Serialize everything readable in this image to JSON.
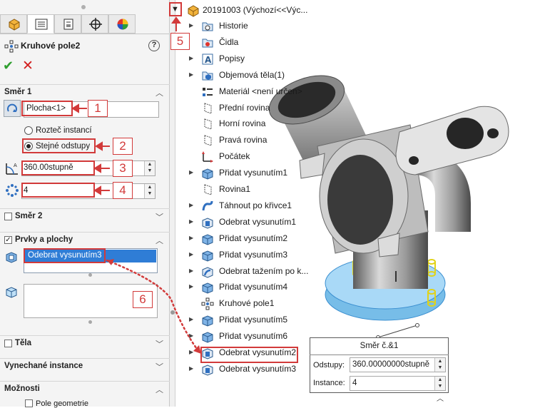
{
  "tabs": [
    {
      "name": "feature-manager",
      "icon": "part-cube-icon"
    },
    {
      "name": "property-manager",
      "icon": "property-list-icon",
      "active": true
    },
    {
      "name": "configuration-manager",
      "icon": "configuration-icon"
    },
    {
      "name": "dimxpert-manager",
      "icon": "crosshair-icon"
    },
    {
      "name": "display-manager",
      "icon": "appearance-sphere-icon"
    }
  ],
  "feature": {
    "title": "Kruhové pole2",
    "help": "?",
    "ok": "✔",
    "cancel": "✕"
  },
  "direction1": {
    "section_label": "Směr 1",
    "axis_value": "Plocha<1>",
    "radio_spacing": "Rozteč instancí",
    "radio_equal": "Stejné odstupy",
    "angle_value": "360.00stupně",
    "count_value": "4"
  },
  "direction2": {
    "section_label": "Směr 2"
  },
  "features_faces": {
    "section_label": "Prvky a plochy",
    "selected_item": "Odebrat vysunutím3"
  },
  "bodies": {
    "section_label": "Těla"
  },
  "skipped": {
    "section_label": "Vynechané instance"
  },
  "options": {
    "section_label": "Možnosti",
    "geometry_pattern": "Pole geometrie"
  },
  "tree": {
    "root": "20191003  (Výchozí<<Výc...",
    "items": [
      {
        "label": "Historie",
        "icon": "history-folder-icon",
        "arrow": "▶"
      },
      {
        "label": "Čidla",
        "icon": "sensor-icon",
        "arrow": ""
      },
      {
        "label": "Popisy",
        "icon": "annotations-icon",
        "arrow": "▶"
      },
      {
        "label": "Objemová těla(1)",
        "icon": "solid-bodies-icon",
        "arrow": "▶"
      },
      {
        "label": "Materiál <není určen>",
        "icon": "material-icon",
        "arrow": ""
      },
      {
        "label": "Přední rovina",
        "icon": "plane-icon",
        "arrow": ""
      },
      {
        "label": "Horní rovina",
        "icon": "plane-icon",
        "arrow": ""
      },
      {
        "label": "Pravá rovina",
        "icon": "plane-icon",
        "arrow": ""
      },
      {
        "label": "Počátek",
        "icon": "origin-icon",
        "arrow": ""
      },
      {
        "label": "Přidat vysunutím1",
        "icon": "boss-extrude-icon",
        "arrow": "▶"
      },
      {
        "label": "Rovina1",
        "icon": "plane-icon",
        "arrow": ""
      },
      {
        "label": "Táhnout po křivce1",
        "icon": "sweep-icon",
        "arrow": "▶"
      },
      {
        "label": "Odebrat vysunutím1",
        "icon": "cut-extrude-icon",
        "arrow": "▶"
      },
      {
        "label": "Přidat vysunutím2",
        "icon": "boss-extrude-icon",
        "arrow": "▶"
      },
      {
        "label": "Přidat vysunutím3",
        "icon": "boss-extrude-icon",
        "arrow": "▶"
      },
      {
        "label": "Odebrat tažením po k...",
        "icon": "cut-sweep-icon",
        "arrow": "▶"
      },
      {
        "label": "Přidat vysunutím4",
        "icon": "boss-extrude-icon",
        "arrow": "▶"
      },
      {
        "label": "Kruhové pole1",
        "icon": "circular-pattern-icon",
        "arrow": ""
      },
      {
        "label": "Přidat vysunutím5",
        "icon": "boss-extrude-icon",
        "arrow": "▶"
      },
      {
        "label": "Přidat vysunutím6",
        "icon": "boss-extrude-icon",
        "arrow": "▶"
      },
      {
        "label": "Odebrat vysunutím2",
        "icon": "cut-extrude-icon",
        "arrow": "▶"
      },
      {
        "label": "Odebrat vysunutím3",
        "icon": "cut-extrude-icon",
        "arrow": "▶"
      }
    ]
  },
  "callouts": {
    "c1": "1",
    "c2": "2",
    "c3": "3",
    "c4": "4",
    "c5": "5",
    "c6": "6"
  },
  "tag": {
    "title": "Směr č.&1",
    "spacing_label": "Odstupy:",
    "spacing_value": "360.00000000stupně",
    "instances_label": "Instance:",
    "instances_value": "4"
  },
  "colors": {
    "annotation": "#d23a3a",
    "selection": "#2f7dd6",
    "ok": "#2e9e2e",
    "cancel": "#d21d1d"
  }
}
